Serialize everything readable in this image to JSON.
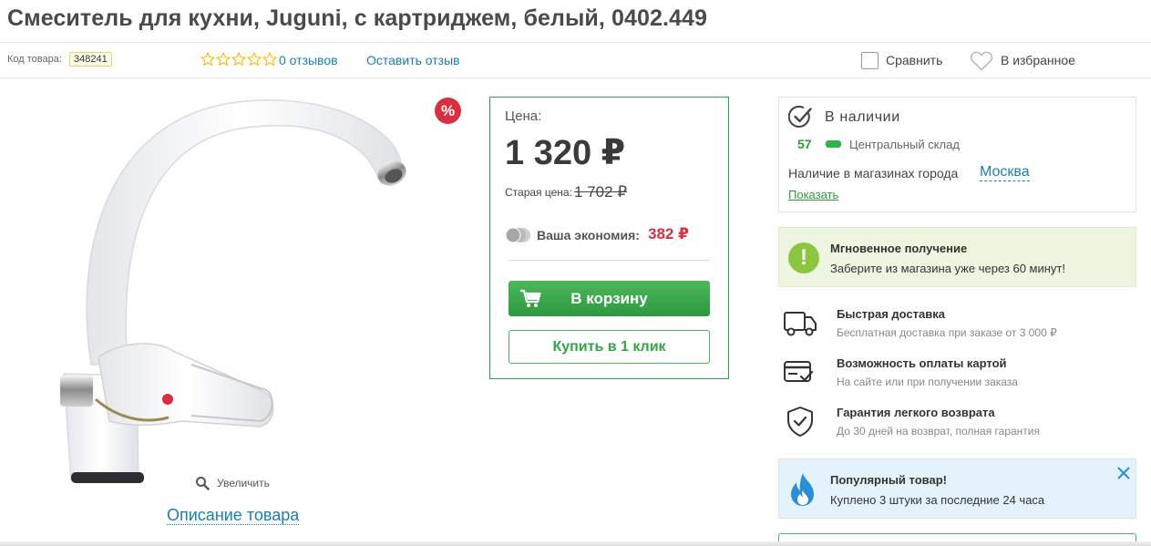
{
  "product": {
    "title": "Смеситель для кухни, Juguni, с картриджем, белый, 0402.449",
    "sku_label": "Код товара:",
    "sku_value": "348241",
    "rating": 0,
    "rating_max": 5,
    "reviews_text": "0 отзывов",
    "leave_review": "Оставить отзыв"
  },
  "actions": {
    "compare": "Сравнить",
    "favorite": "В избранное"
  },
  "gallery": {
    "discount_badge": "%",
    "zoom": "Увеличить",
    "description_link": "Описание товара"
  },
  "price": {
    "label": "Цена:",
    "current": "1 320 ₽",
    "old_label": "Старая цена:",
    "old": "1 702 ₽",
    "savings_label": "Ваша экономия:",
    "savings": "382 ₽",
    "cart_button": "В корзину",
    "one_click": "Купить в 1 клик"
  },
  "stock": {
    "status": "В наличии",
    "count": "57",
    "warehouse": "Центральный склад",
    "city_label": "Наличие в магазинах города",
    "city": "Москва",
    "show": "Показать"
  },
  "instant": {
    "title": "Мгновенное получение",
    "text": "Заберите из магазина уже через 60 минут!"
  },
  "features": [
    {
      "icon": "truck-icon",
      "title": "Быстрая доставка",
      "text": "Бесплатная доставка при заказе от 3 000 ₽"
    },
    {
      "icon": "card-icon",
      "title": "Возможность оплаты картой",
      "text": "На сайте или при получении заказа"
    },
    {
      "icon": "shield-icon",
      "title": "Гарантия легкого возврата",
      "text": "До 30 дней на возврат, полная гарантия"
    }
  ],
  "popular": {
    "title": "Популярный товар!",
    "text": "Куплено 3 штуки за последние 24 часа"
  },
  "colors": {
    "green": "#2e9940",
    "red": "#d9303f",
    "link": "#1a7eb5",
    "star": "#f5b800"
  }
}
